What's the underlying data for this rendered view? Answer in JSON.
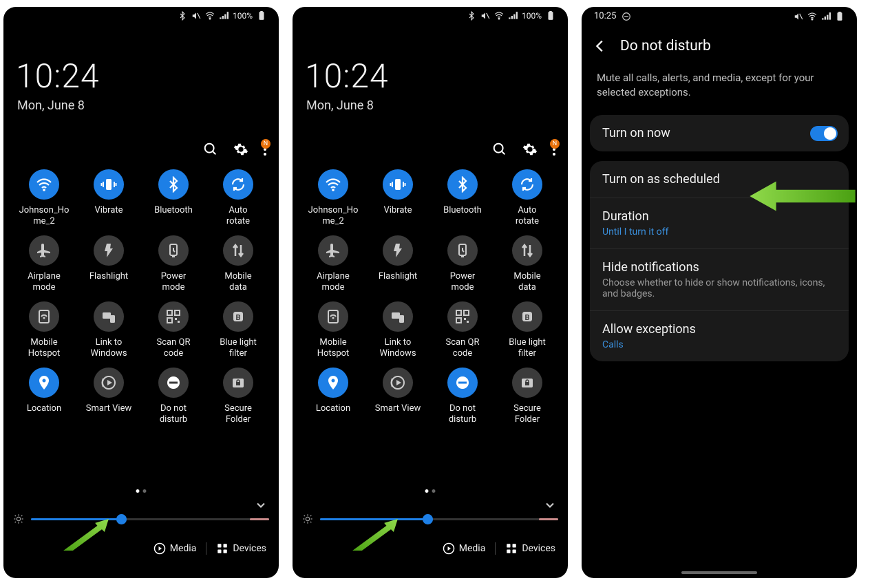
{
  "status": {
    "battery": "100%",
    "time3": "10:25",
    "badge_letter": "N"
  },
  "clock": {
    "time": "10:24",
    "date": "Mon, June 8"
  },
  "tiles": [
    {
      "label": "Johnson_Ho\nme_2",
      "active": true,
      "icon": "wifi"
    },
    {
      "label": "Vibrate",
      "active": true,
      "icon": "vibrate"
    },
    {
      "label": "Bluetooth",
      "active": true,
      "icon": "bluetooth"
    },
    {
      "label": "Auto\nrotate",
      "active": true,
      "icon": "rotate"
    },
    {
      "label": "Airplane\nmode",
      "active": false,
      "icon": "plane"
    },
    {
      "label": "Flashlight",
      "active": false,
      "icon": "flash"
    },
    {
      "label": "Power\nmode",
      "active": false,
      "icon": "power"
    },
    {
      "label": "Mobile\ndata",
      "active": false,
      "icon": "mdata"
    },
    {
      "label": "Mobile\nHotspot",
      "active": false,
      "icon": "hotspot"
    },
    {
      "label": "Link to\nWindows",
      "active": false,
      "icon": "link"
    },
    {
      "label": "Scan QR\ncode",
      "active": false,
      "icon": "qr"
    },
    {
      "label": "Blue light\nfilter",
      "active": false,
      "icon": "bluelight"
    },
    {
      "label": "Location",
      "active": true,
      "icon": "location"
    },
    {
      "label": "Smart View",
      "active": false,
      "icon": "smartview"
    },
    {
      "label": "Do not\ndisturb",
      "active": false,
      "icon": "dnd"
    },
    {
      "label": "Secure\nFolder",
      "active": false,
      "icon": "secure"
    }
  ],
  "panel2_dnd_active": true,
  "slider": {
    "percent1": 38,
    "percent2": 45
  },
  "bottom": {
    "media": "Media",
    "devices": "Devices"
  },
  "panel3": {
    "title": "Do not disturb",
    "desc": "Mute all calls, alerts, and media, except for your selected exceptions.",
    "turn_on_now": "Turn on now",
    "turn_on_scheduled": "Turn on as scheduled",
    "duration": "Duration",
    "duration_sub": "Until I turn it off",
    "hide": "Hide notifications",
    "hide_sub": "Choose whether to hide or show notifications, icons, and badges.",
    "allow": "Allow exceptions",
    "allow_sub": "Calls"
  }
}
